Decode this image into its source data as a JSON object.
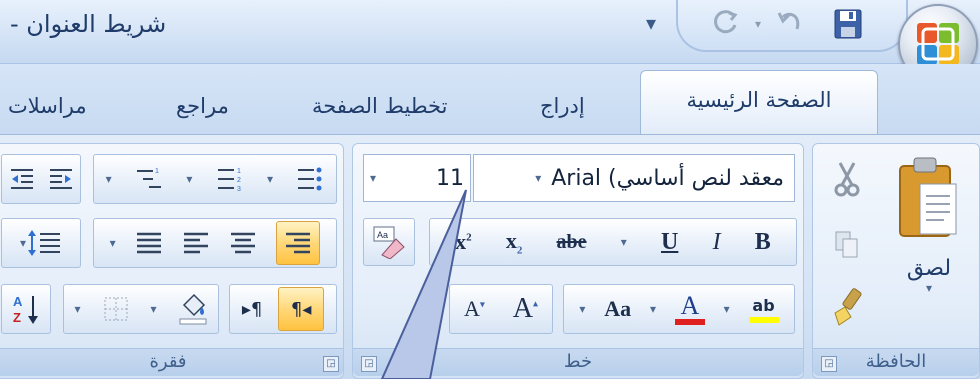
{
  "titlebar": {
    "title": "شريط العنوان -",
    "customize_glyph": "▾",
    "office_button": "office-logo-icon"
  },
  "tabs": {
    "home": "الصفحة الرئيسية",
    "insert": "إدراج",
    "page_layout": "تخطيط الصفحة",
    "references": "مراجع",
    "mailings": "مراسلات"
  },
  "clipboard": {
    "group_label": "الحافظة",
    "paste_label": "لصق",
    "paste_arrow": "▾"
  },
  "font": {
    "group_label": "خط",
    "font_name": "معقد لنص أساسي) Arial",
    "font_size": "11",
    "bold": "B",
    "italic": "I",
    "underline": "U",
    "strikethrough": "abe",
    "subscript": "x",
    "subscript_mark": "2",
    "superscript_mark": "2",
    "grow": "A",
    "shrink": "A",
    "change_case": "Aa",
    "font_color": "A",
    "highlight": "ab",
    "clear_format": "Aa",
    "colors": {
      "font_color": "#e0201f",
      "highlight": "#ffff00"
    }
  },
  "paragraph": {
    "group_label": "فقرة",
    "sort": "A↓"
  },
  "launcher_glyph": "◲"
}
